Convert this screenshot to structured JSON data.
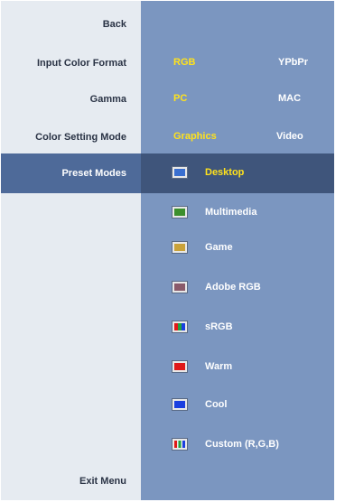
{
  "left_menu": {
    "back": "Back",
    "input_color_format": "Input Color Format",
    "gamma": "Gamma",
    "color_setting_mode": "Color Setting Mode",
    "preset_modes": "Preset Modes",
    "exit_menu": "Exit Menu"
  },
  "input_color_format": {
    "options": [
      "RGB",
      "YPbPr"
    ],
    "selected": "RGB"
  },
  "gamma": {
    "options": [
      "PC",
      "MAC"
    ],
    "selected": "PC"
  },
  "color_setting_mode": {
    "options": [
      "Graphics",
      "Video"
    ],
    "selected": "Graphics"
  },
  "presets": {
    "selected": "Desktop",
    "items": [
      {
        "label": "Desktop",
        "icon": "desktop-icon",
        "color": "#3a6fd0"
      },
      {
        "label": "Multimedia",
        "icon": "multimedia-icon",
        "color": "#3c8f2c"
      },
      {
        "label": "Game",
        "icon": "game-icon",
        "color": "#c9a23a"
      },
      {
        "label": "Adobe RGB",
        "icon": "adobe-rgb-icon",
        "color": "#8a5a6a"
      },
      {
        "label": "sRGB",
        "icon": "srgb-icon",
        "color": "#22a340"
      },
      {
        "label": "Warm",
        "icon": "warm-icon",
        "color": "#e01818"
      },
      {
        "label": "Cool",
        "icon": "cool-icon",
        "color": "#1a3fe0"
      },
      {
        "label": "Custom (R,G,B)",
        "icon": "custom-rgb-icon",
        "color": "#d23030"
      }
    ]
  },
  "colors": {
    "left_panel": "#e6ebf1",
    "right_panel": "#7b96c0",
    "active_row": "#3f557b",
    "selected_text": "#ffe21c"
  }
}
